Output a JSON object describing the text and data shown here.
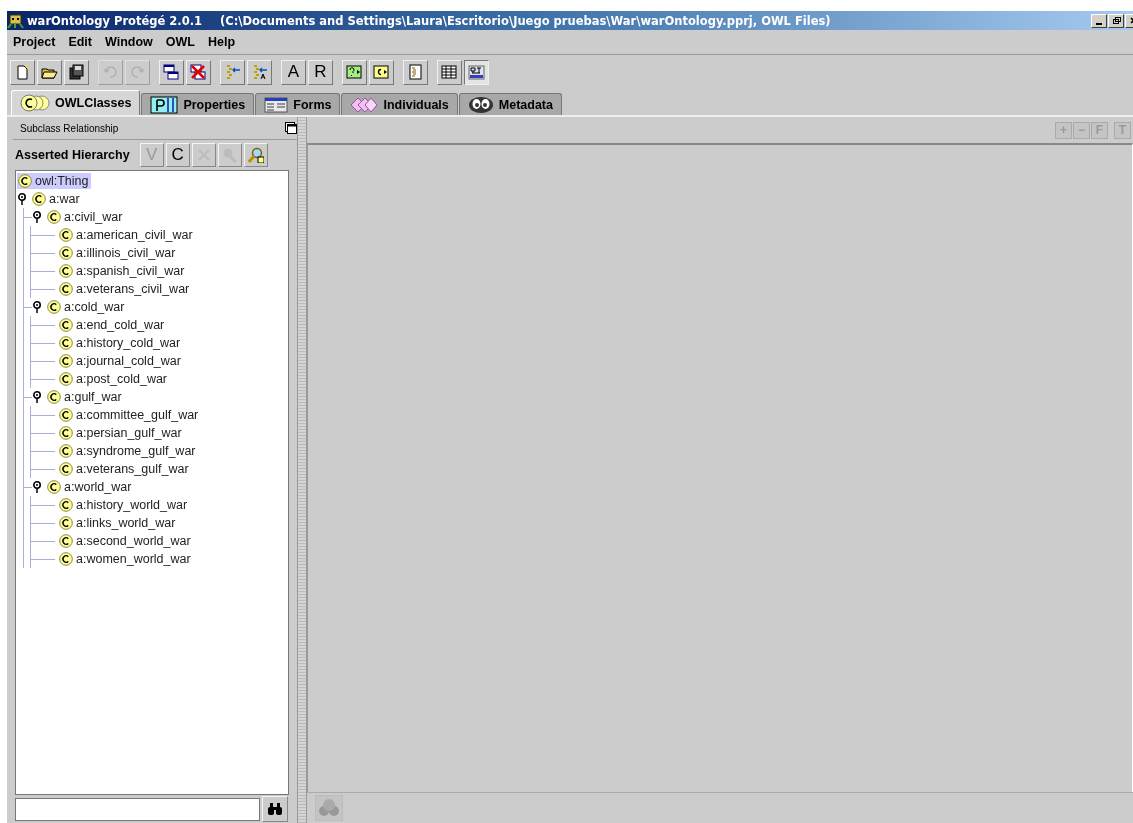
{
  "window": {
    "app_title": "warOntology  Protégé 2.0.1",
    "file_path": "(C:\\Documents and Settings\\Laura\\Escritorio\\Juego pruebas\\War\\warOntology.pprj, OWL Files)"
  },
  "menu": [
    "Project",
    "Edit",
    "Window",
    "OWL",
    "Help"
  ],
  "toolbar": [
    {
      "buttons": [
        {
          "kind": "icon",
          "disabled": false,
          "pressed": false
        },
        {
          "kind": "icon",
          "disabled": false,
          "pressed": false
        },
        {
          "kind": "icon",
          "disabled": false,
          "pressed": false
        }
      ]
    },
    {
      "buttons": [
        {
          "kind": "icon",
          "disabled": true,
          "pressed": false
        },
        {
          "kind": "icon",
          "disabled": true,
          "pressed": false
        }
      ]
    },
    {
      "buttons": [
        {
          "kind": "icon",
          "disabled": false,
          "pressed": false
        },
        {
          "kind": "icon",
          "disabled": false,
          "pressed": false
        }
      ]
    },
    {
      "buttons": [
        {
          "kind": "icon",
          "disabled": false,
          "pressed": false
        },
        {
          "kind": "icon",
          "disabled": false,
          "pressed": false
        }
      ]
    },
    {
      "buttons": [
        {
          "kind": "text",
          "label": "A",
          "disabled": false,
          "pressed": false
        },
        {
          "kind": "text",
          "label": "R",
          "disabled": false,
          "pressed": false
        }
      ]
    },
    {
      "buttons": [
        {
          "kind": "icon",
          "disabled": false,
          "pressed": false
        },
        {
          "kind": "icon",
          "disabled": false,
          "pressed": false
        }
      ]
    },
    {
      "buttons": [
        {
          "kind": "icon",
          "disabled": false,
          "pressed": false
        }
      ]
    },
    {
      "buttons": [
        {
          "kind": "icon",
          "disabled": false,
          "pressed": false
        },
        {
          "kind": "icon",
          "disabled": false,
          "pressed": true
        }
      ]
    }
  ],
  "tabs": [
    {
      "label": "OWLClasses",
      "selected": true
    },
    {
      "label": "Properties",
      "selected": false
    },
    {
      "label": "Forms",
      "selected": false
    },
    {
      "label": "Individuals",
      "selected": false
    },
    {
      "label": "Metadata",
      "selected": false
    }
  ],
  "left_panel": {
    "title": "Subclass Relationship",
    "hierarchy_label": "Asserted Hierarchy",
    "buttons": [
      {
        "kind": "text",
        "label": "V",
        "disabled": true
      },
      {
        "kind": "text",
        "label": "C",
        "disabled": false
      },
      {
        "kind": "icon",
        "disabled": true
      },
      {
        "kind": "icon",
        "disabled": true
      },
      {
        "kind": "icon",
        "disabled": false
      }
    ],
    "tree": {
      "label": "owl:Thing",
      "selected": true,
      "children": [
        {
          "label": "a:war",
          "selected": false,
          "expanded": true,
          "children": [
            {
              "label": "a:civil_war",
              "selected": false,
              "expanded": true,
              "children": [
                {
                  "label": "a:american_civil_war",
                  "selected": false
                },
                {
                  "label": "a:illinois_civil_war",
                  "selected": false
                },
                {
                  "label": "a:spanish_civil_war",
                  "selected": false
                },
                {
                  "label": "a:veterans_civil_war",
                  "selected": false
                }
              ]
            },
            {
              "label": "a:cold_war",
              "selected": false,
              "expanded": true,
              "children": [
                {
                  "label": "a:end_cold_war",
                  "selected": false
                },
                {
                  "label": "a:history_cold_war",
                  "selected": false
                },
                {
                  "label": "a:journal_cold_war",
                  "selected": false
                },
                {
                  "label": "a:post_cold_war",
                  "selected": false
                }
              ]
            },
            {
              "label": "a:gulf_war",
              "selected": false,
              "expanded": true,
              "children": [
                {
                  "label": "a:committee_gulf_war",
                  "selected": false
                },
                {
                  "label": "a:persian_gulf_war",
                  "selected": false
                },
                {
                  "label": "a:syndrome_gulf_war",
                  "selected": false
                },
                {
                  "label": "a:veterans_gulf_war",
                  "selected": false
                }
              ]
            },
            {
              "label": "a:world_war",
              "selected": false,
              "expanded": true,
              "children": [
                {
                  "label": "a:history_world_war",
                  "selected": false
                },
                {
                  "label": "a:links_world_war",
                  "selected": false
                },
                {
                  "label": "a:second_world_war",
                  "selected": false
                },
                {
                  "label": "a:women_world_war",
                  "selected": false
                }
              ]
            }
          ]
        }
      ]
    }
  },
  "right_panel": {
    "buttons": [
      {
        "label": "+",
        "disabled": true
      },
      {
        "label": "−",
        "disabled": true
      },
      {
        "label": "F",
        "disabled": true
      },
      {
        "label": "T",
        "disabled": true
      }
    ]
  }
}
